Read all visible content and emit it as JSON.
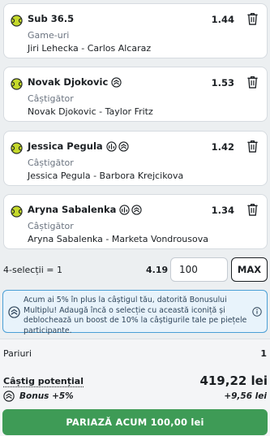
{
  "colors": {
    "accent_green": "#3e9b56",
    "ball_green": "#c5d92b",
    "bonus_bg": "#e8f3fb",
    "bonus_border": "#4a9fd6"
  },
  "selections": [
    {
      "title": "Sub 36.5",
      "odds": "1.44",
      "market": "Game-uri",
      "event": "Jiri Lehecka - Carlos Alcaraz",
      "badges": []
    },
    {
      "title": "Novak Djokovic",
      "odds": "1.53",
      "market": "Câștigător",
      "event": "Novak Djokovic - Taylor Fritz",
      "badges": [
        "bonus-icon"
      ]
    },
    {
      "title": "Jessica Pegula",
      "odds": "1.42",
      "market": "Câștigător",
      "event": "Jessica Pegula - Barbora Krejcikova",
      "badges": [
        "statistics-icon",
        "bonus-icon"
      ]
    },
    {
      "title": "Aryna Sabalenka",
      "odds": "1.34",
      "market": "Câștigător",
      "event": "Aryna Sabalenka - Marketa Vondrousova",
      "badges": [
        "statistics-icon",
        "bonus-icon"
      ]
    }
  ],
  "stake": {
    "selections_label": "4-selecții = 1",
    "total_odds": "4.19",
    "amount": "100",
    "max_label": "MAX"
  },
  "bonus_notice": {
    "text": "Acum ai 5% în plus la câștigul tău, datorită Bonusului Multiplu! Adaugă încă o selecție cu această iconiță și deblochează un boost de 10% la câștigurile tale pe piețele participante."
  },
  "summary": {
    "bets_label": "Pariuri",
    "bets_count": "1",
    "potential_win_label": "Câștig potențial",
    "potential_win_value": "419,22 lei",
    "bonus_label": "Bonus +5%",
    "bonus_value": "+9,56 lei"
  },
  "place_bet_label": "PARIAZĂ ACUM 100,00 lei"
}
